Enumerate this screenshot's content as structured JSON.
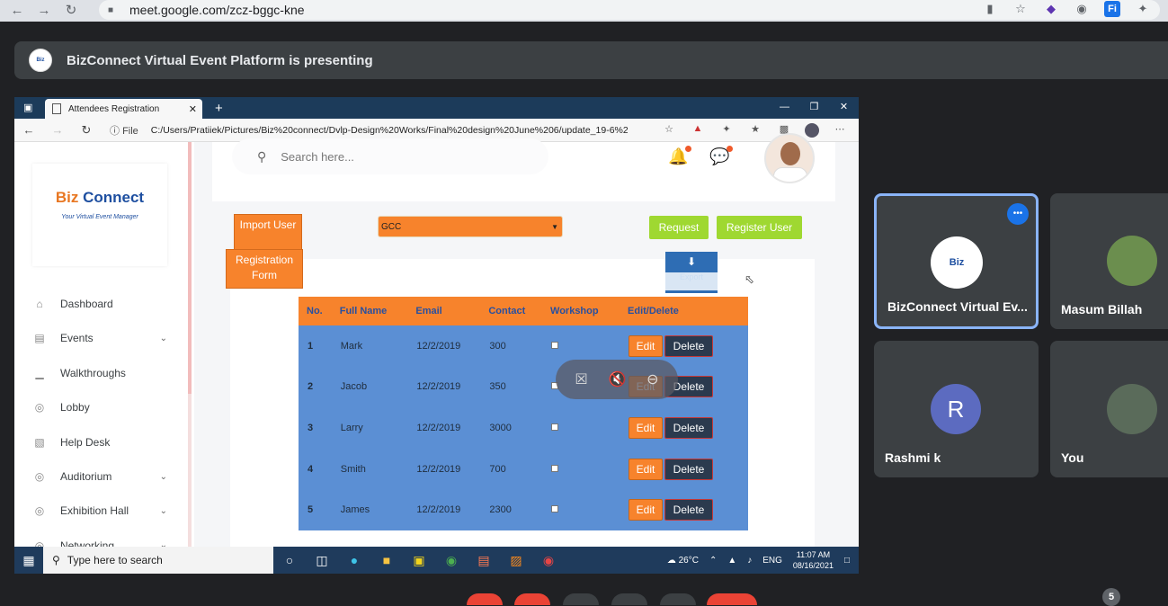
{
  "browser": {
    "url": "meet.google.com/zcz-bggc-kne"
  },
  "banner": {
    "presenting_text": "BizConnect Virtual Event Platform is presenting"
  },
  "shared_window": {
    "tab_title": "Attendees Registration",
    "address_prefix": "File",
    "address_path": "C:/Users/Pratiiek/Pictures/Biz%20connect/Dvlp-Design%20Works/Final%20design%20June%206/update_19-6%20(..."
  },
  "app": {
    "brand_biz": "Biz",
    "brand_connect": " Connect",
    "brand_tagline": "Your Virtual Event Manager",
    "search_placeholder": "Search here...",
    "sidebar": [
      {
        "label": "Dashboard",
        "icon": "home-icon",
        "chevron": false
      },
      {
        "label": "Events",
        "icon": "events-icon",
        "chevron": true
      },
      {
        "label": "Walkthroughs",
        "icon": "chart-icon",
        "chevron": false
      },
      {
        "label": "Lobby",
        "icon": "globe-icon",
        "chevron": false
      },
      {
        "label": "Help Desk",
        "icon": "helpdesk-icon",
        "chevron": false
      },
      {
        "label": "Auditorium",
        "icon": "globe-icon",
        "chevron": true
      },
      {
        "label": "Exhibition Hall",
        "icon": "globe-icon",
        "chevron": true
      },
      {
        "label": "Networking",
        "icon": "globe-icon",
        "chevron": true
      }
    ],
    "import_user": "Import User",
    "registration_form": "Registration Form",
    "event_select": "GCC",
    "request": "Request",
    "register_user": "Register User",
    "export_label": "Export",
    "table": {
      "headers": [
        "No.",
        "Full Name",
        "Email",
        "Contact",
        "Workshop",
        "Edit/Delete"
      ],
      "rows": [
        {
          "no": "1",
          "name": "Mark",
          "email": "12/2/2019",
          "contact": "300"
        },
        {
          "no": "2",
          "name": "Jacob",
          "email": "12/2/2019",
          "contact": "350"
        },
        {
          "no": "3",
          "name": "Larry",
          "email": "12/2/2019",
          "contact": "3000"
        },
        {
          "no": "4",
          "name": "Smith",
          "email": "12/2/2019",
          "contact": "700"
        },
        {
          "no": "5",
          "name": "James",
          "email": "12/2/2019",
          "contact": "2300"
        }
      ],
      "edit_label": "Edit",
      "delete_label": "Delete"
    }
  },
  "taskbar": {
    "search_placeholder": "Type here to search",
    "weather": "26°C",
    "lang": "ENG",
    "time": "11:07 AM",
    "date": "08/16/2021"
  },
  "participants": [
    {
      "name": "BizConnect Virtual Ev...",
      "active": true
    },
    {
      "name": "Masum Billah",
      "active": false
    },
    {
      "name": "Rashmi k",
      "initial": "R",
      "active": false
    },
    {
      "name": "You",
      "active": false
    }
  ],
  "participant_count": "5",
  "colors": {
    "orange": "#f7832c",
    "green": "#9fd831",
    "table_blue": "#5b8fd4",
    "meet_tile": "#3c4043",
    "avatar_purple": "#5c6bc0"
  }
}
